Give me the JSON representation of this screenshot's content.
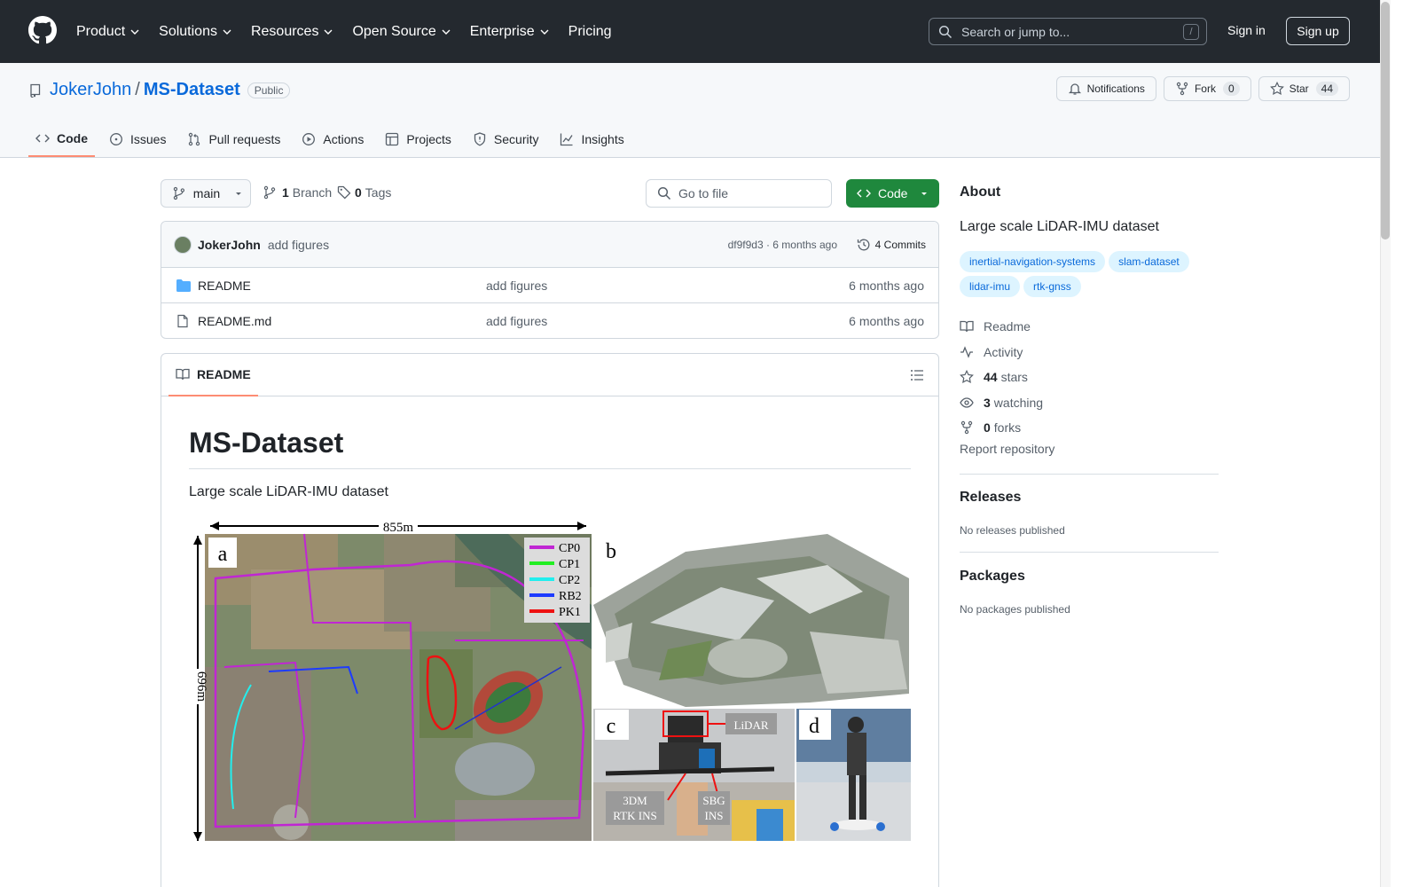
{
  "header": {
    "nav": [
      "Product",
      "Solutions",
      "Resources",
      "Open Source",
      "Enterprise",
      "Pricing"
    ],
    "search_placeholder": "Search or jump to...",
    "search_shortcut": "/",
    "sign_in": "Sign in",
    "sign_up": "Sign up"
  },
  "repo": {
    "owner": "JokerJohn",
    "separator": "/",
    "name": "MS-Dataset",
    "visibility": "Public",
    "notifications_label": "Notifications",
    "fork_label": "Fork",
    "fork_count": "0",
    "star_label": "Star",
    "star_count": "44",
    "tabs": [
      "Code",
      "Issues",
      "Pull requests",
      "Actions",
      "Projects",
      "Security",
      "Insights"
    ]
  },
  "toolbar": {
    "branch": "main",
    "branch_count": "1",
    "branch_label": "Branch",
    "tag_count": "0",
    "tag_label": "Tags",
    "goto_file": "Go to file",
    "code_button": "Code"
  },
  "commit": {
    "author": "JokerJohn",
    "message": "add figures",
    "meta": "df9f9d3 · 6 months ago",
    "commits": "4 Commits"
  },
  "files": [
    {
      "type": "folder",
      "name": "README",
      "message": "add figures",
      "time": "6 months ago"
    },
    {
      "type": "file",
      "name": "README.md",
      "message": "add figures",
      "time": "6 months ago"
    }
  ],
  "readme": {
    "tab": "README",
    "title": "MS-Dataset",
    "description": "Large scale LiDAR-IMU dataset",
    "figure": {
      "width_label": "855m",
      "height_label": "696m",
      "panel_labels": [
        "a",
        "b",
        "c",
        "d"
      ],
      "legend": [
        {
          "name": "CP0",
          "color": "#c026d3"
        },
        {
          "name": "CP1",
          "color": "#22ee22"
        },
        {
          "name": "CP2",
          "color": "#22eeee"
        },
        {
          "name": "RB2",
          "color": "#1d3bff"
        },
        {
          "name": "PK1",
          "color": "#ee1111"
        }
      ],
      "sensor_labels": {
        "lidar": "LiDAR",
        "rtk_line1": "3DM",
        "rtk_line2": "RTK INS",
        "sbg_line1": "SBG",
        "sbg_line2": "INS"
      }
    }
  },
  "about": {
    "heading": "About",
    "description": "Large scale LiDAR-IMU dataset",
    "topics": [
      "inertial-navigation-systems",
      "slam-dataset",
      "lidar-imu",
      "rtk-gnss"
    ],
    "readme": "Readme",
    "activity": "Activity",
    "stars_count": "44",
    "stars_label": "stars",
    "watching_count": "3",
    "watching_label": "watching",
    "forks_count": "0",
    "forks_label": "forks",
    "report": "Report repository"
  },
  "releases": {
    "heading": "Releases",
    "empty": "No releases published"
  },
  "packages": {
    "heading": "Packages",
    "empty": "No packages published"
  }
}
